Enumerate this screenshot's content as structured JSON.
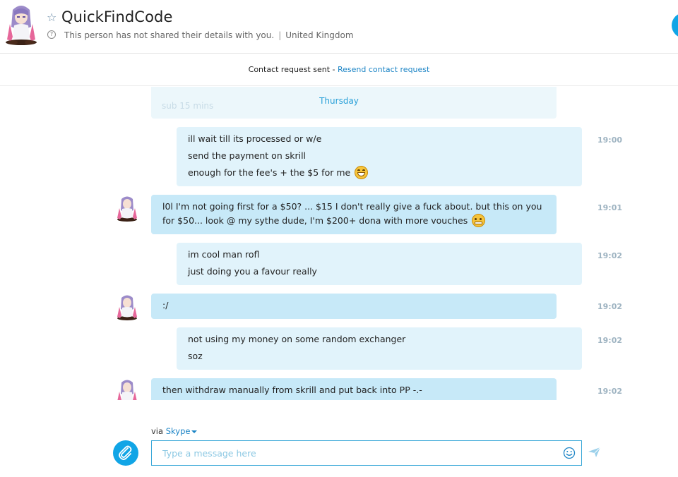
{
  "header": {
    "contact_name": "QuickFindCode",
    "privacy_note": "This person has not shared their details with you.",
    "location": "United Kingdom",
    "separator": "|"
  },
  "request_bar": {
    "status_text": "Contact request sent -",
    "resend_link": "Resend contact request"
  },
  "conversation": {
    "day_label": "Thursday",
    "ghost_text": "sub 15 mins",
    "messages": [
      {
        "direction": "outgoing",
        "time": "19:00",
        "lines": [
          "ill wait till its processed or w/e",
          "send the payment on skrill",
          "enough for the fee's + the $5 for me"
        ],
        "emoji_after_last_line": "grinning-emoji"
      },
      {
        "direction": "incoming",
        "time": "19:01",
        "lines": [
          "l0l I'm not going first for a $50? ... $15 I don't really give a fuck about. but this on you for $50... look @ my sythe dude, I'm $200+ dona with more vouches"
        ],
        "emoji_after_last_line": "grimacing-emoji"
      },
      {
        "direction": "outgoing",
        "time": "19:02",
        "lines": [
          "im cool man rofl",
          "just doing you a favour really"
        ]
      },
      {
        "direction": "incoming",
        "time": "19:02",
        "lines": [
          ":/"
        ]
      },
      {
        "direction": "outgoing",
        "time": "19:02",
        "lines": [
          "not using my money on some random exchanger",
          "soz"
        ]
      },
      {
        "direction": "incoming",
        "time": "19:02",
        "lines": [
          "then withdraw manually from skrill and put back into PP -.-"
        ]
      }
    ]
  },
  "composer": {
    "via_label": "via",
    "via_service": "Skype",
    "placeholder": "Type a message here",
    "value": ""
  },
  "colors": {
    "accent": "#11a5e6",
    "link": "#1d85c6",
    "incoming_bubble": "#c7e9f8",
    "outgoing_bubble": "#e1f3fb",
    "timestamp": "#9fb4c2"
  },
  "icons": [
    "favorite-star-icon",
    "help-icon",
    "attach-paperclip-icon",
    "emoticon-picker-icon",
    "send-arrow-icon",
    "dropdown-caret-icon"
  ]
}
